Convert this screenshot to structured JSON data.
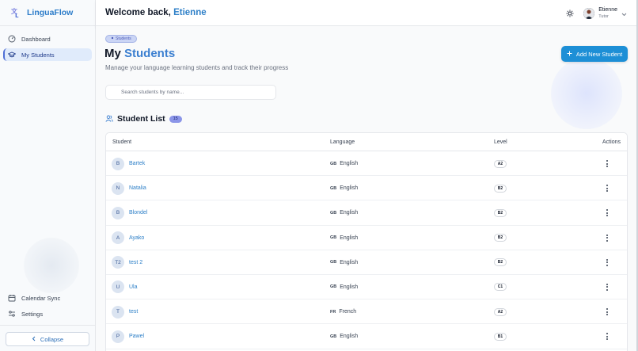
{
  "app": {
    "name": "LinguaFlow"
  },
  "sidebar": {
    "items": [
      {
        "label": "Dashboard",
        "icon": "dashboard-gauge-icon"
      },
      {
        "label": "My Students",
        "icon": "graduation-cap-icon",
        "active": true
      }
    ],
    "bottom_items": [
      {
        "label": "Calendar Sync",
        "icon": "calendar-icon"
      },
      {
        "label": "Settings",
        "icon": "sliders-icon"
      }
    ],
    "collapse_label": "Collapse"
  },
  "header": {
    "welcome_prefix": "Welcome back,",
    "welcome_name": "Etienne",
    "user_name": "Etienne",
    "user_role": "Tutor"
  },
  "main": {
    "breadcrumb": "Students",
    "title_prefix": "My",
    "title_accent": "Students",
    "subtitle": "Manage your language learning students and track their progress",
    "add_button_label": "Add New Student",
    "search_placeholder": "Search students by name...",
    "list_title": "Student List",
    "student_count": "15",
    "columns": {
      "student": "Student",
      "language": "Language",
      "level": "Level",
      "actions": "Actions"
    },
    "students": [
      {
        "initials": "B",
        "name": "Bartek",
        "flag": "GB",
        "language": "English",
        "level": "A2"
      },
      {
        "initials": "N",
        "name": "Natalia",
        "flag": "GB",
        "language": "English",
        "level": "B2"
      },
      {
        "initials": "B",
        "name": "Blondel",
        "flag": "GB",
        "language": "English",
        "level": "B2"
      },
      {
        "initials": "A",
        "name": "Ayako",
        "flag": "GB",
        "language": "English",
        "level": "B2"
      },
      {
        "initials": "T2",
        "name": "test 2",
        "flag": "GB",
        "language": "English",
        "level": "B2"
      },
      {
        "initials": "U",
        "name": "Ula",
        "flag": "GB",
        "language": "English",
        "level": "C1"
      },
      {
        "initials": "T",
        "name": "test",
        "flag": "FR",
        "language": "French",
        "level": "A2"
      },
      {
        "initials": "P",
        "name": "Pawel",
        "flag": "GB",
        "language": "English",
        "level": "B1"
      }
    ]
  },
  "colors": {
    "brand": "#2c7cc9",
    "accent": "#3b7fd0",
    "primary_button": "#1d8fd6",
    "count_badge": "#8b95e8"
  }
}
